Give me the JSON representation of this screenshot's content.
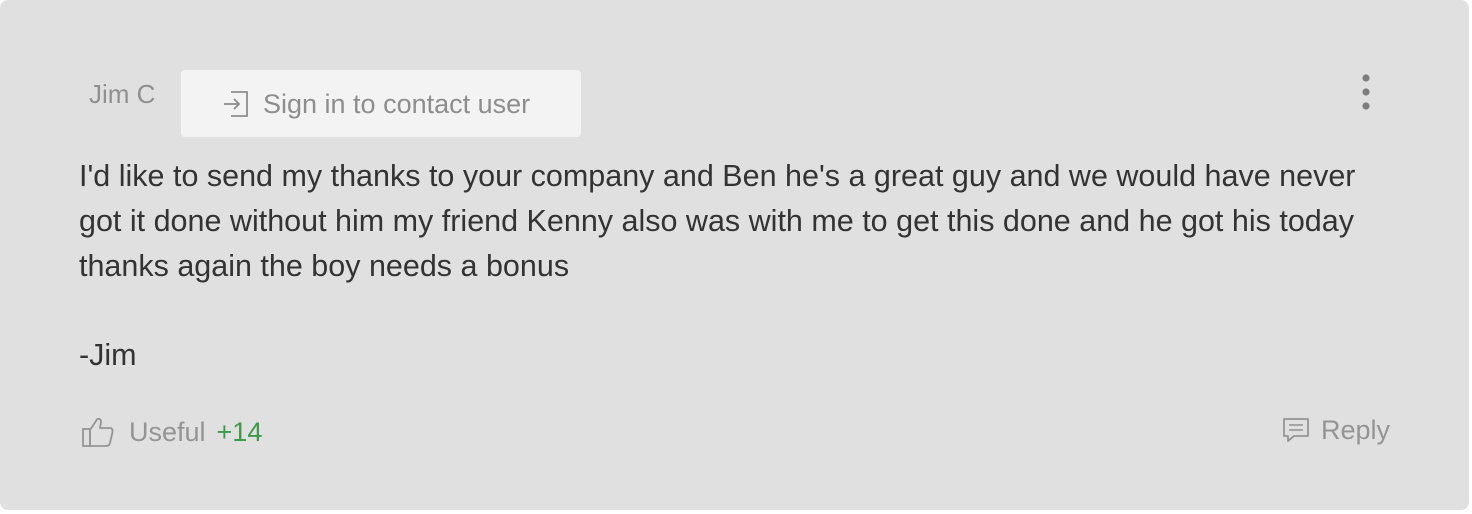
{
  "review": {
    "author": "Jim C",
    "contact_button_label": "Sign in to contact user",
    "body": "I'd like to send my thanks to your company and Ben he's a great guy and we would have never got it done without him my friend Kenny also was with me to get this done and he got his today thanks again the boy needs a bonus",
    "signature": "-Jim",
    "useful_label": "Useful",
    "useful_count": "+14",
    "reply_label": "Reply"
  },
  "icons": {
    "contact": "sign-in-icon",
    "menu": "more-vertical-icon",
    "useful": "thumbs-up-icon",
    "reply": "comment-icon"
  },
  "colors": {
    "card_background": "#e0e0e0",
    "useful_count": "#3e9a48",
    "muted_text": "#949494",
    "body_text": "#333333"
  }
}
